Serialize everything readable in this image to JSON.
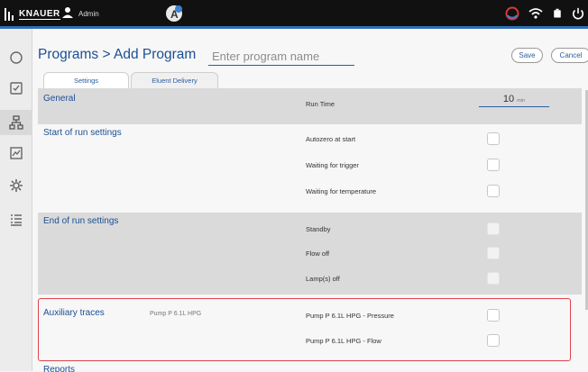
{
  "topbar": {
    "brand": "KNAUER",
    "user": "Admin",
    "icons": [
      "knauer-logo-icon",
      "user-icon",
      "assistant-badge-icon",
      "power-status-icon",
      "wifi-icon",
      "battery-icon",
      "power-icon"
    ]
  },
  "sidebar": {
    "items": [
      {
        "icon": "circle-icon"
      },
      {
        "icon": "checklist-icon"
      },
      {
        "icon": "network-icon",
        "active": true
      },
      {
        "icon": "chart-icon"
      },
      {
        "icon": "gear-icon"
      },
      {
        "icon": "list-icon"
      }
    ]
  },
  "header": {
    "breadcrumb": "Programs  >  Add Program",
    "name_placeholder": "Enter program name",
    "save_label": "Save",
    "cancel_label": "Cancel"
  },
  "tabs": [
    "Settings",
    "Eluent Delivery"
  ],
  "sections": {
    "general": {
      "title": "General",
      "run_time_label": "Run Time",
      "run_time_value": "10",
      "run_time_unit": "min"
    },
    "start": {
      "title": "Start of run settings",
      "rows": [
        "Autozero at start",
        "Waiting for trigger",
        "Waiting for temperature"
      ]
    },
    "end": {
      "title": "End of run settings",
      "rows": [
        "Standby",
        "Flow off",
        "Lamp(s) off"
      ]
    },
    "aux": {
      "title": "Auxiliary traces",
      "subtitle": "Pump P 6.1L HPG",
      "rows": [
        "Pump P 6.1L HPG - Pressure",
        "Pump P 6.1L HPG - Flow"
      ]
    },
    "reports": {
      "title": "Reports"
    }
  },
  "colors": {
    "accent": "#1a4f94",
    "highlight": "#e0434b",
    "topbar": "#111111"
  }
}
